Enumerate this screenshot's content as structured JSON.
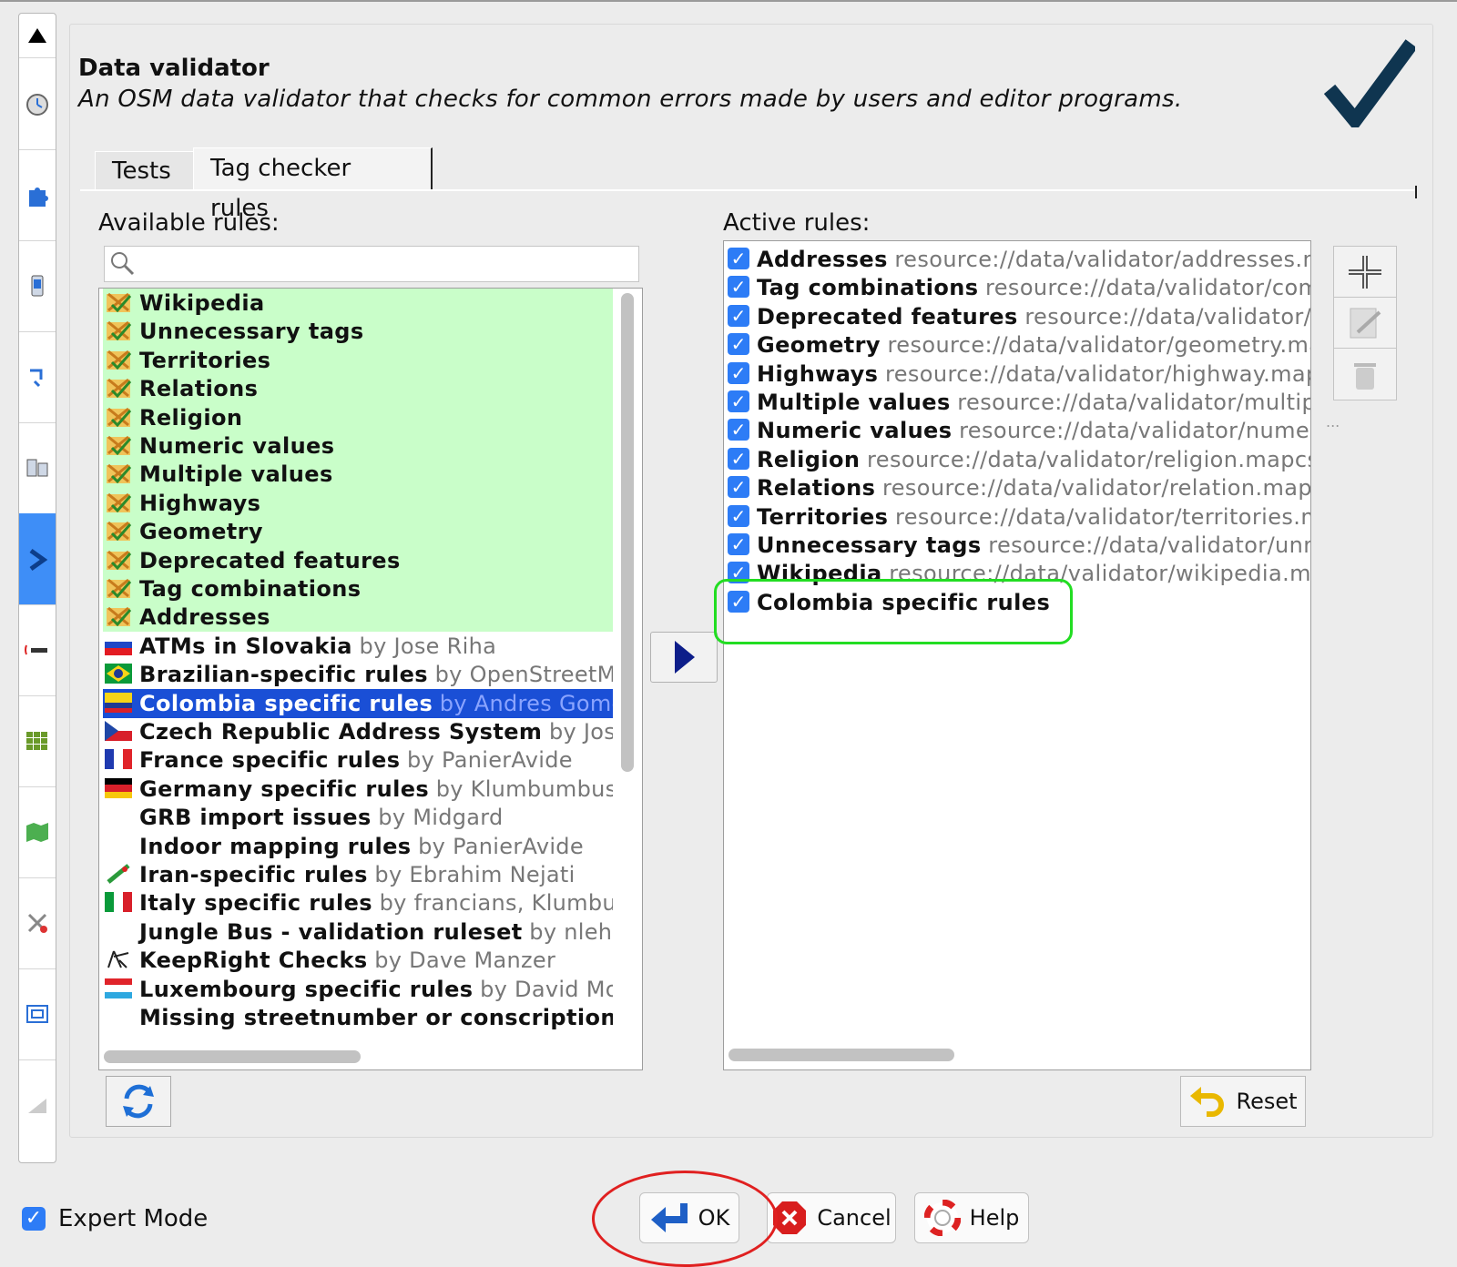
{
  "header": {
    "title": "Data validator",
    "subtitle": "An OSM data validator that checks for common errors made by users and editor programs."
  },
  "tabs": [
    {
      "label": "Tests"
    },
    {
      "label": "Tag checker rules",
      "selected": true
    }
  ],
  "available": {
    "label": "Available rules:",
    "search_placeholder": "",
    "items": [
      {
        "name": "Wikipedia",
        "by": "",
        "icon": "josm-validator-icon",
        "active": true
      },
      {
        "name": "Unnecessary tags",
        "by": "",
        "icon": "josm-validator-icon",
        "active": true
      },
      {
        "name": "Territories",
        "by": "",
        "icon": "josm-validator-icon",
        "active": true
      },
      {
        "name": "Relations",
        "by": "",
        "icon": "josm-validator-icon",
        "active": true
      },
      {
        "name": "Religion",
        "by": "",
        "icon": "josm-validator-icon",
        "active": true
      },
      {
        "name": "Numeric values",
        "by": "",
        "icon": "josm-validator-icon",
        "active": true
      },
      {
        "name": "Multiple values",
        "by": "",
        "icon": "josm-validator-icon",
        "active": true
      },
      {
        "name": "Highways",
        "by": "",
        "icon": "josm-validator-icon",
        "active": true
      },
      {
        "name": "Geometry",
        "by": "",
        "icon": "josm-validator-icon",
        "active": true
      },
      {
        "name": "Deprecated features",
        "by": "",
        "icon": "josm-validator-icon",
        "active": true
      },
      {
        "name": "Tag combinations",
        "by": "",
        "icon": "josm-validator-icon",
        "active": true
      },
      {
        "name": "Addresses",
        "by": "",
        "icon": "josm-validator-icon",
        "active": true
      },
      {
        "name": "ATMs in Slovakia",
        "by": "by Jose Riha",
        "icon": "flag-slovakia-icon"
      },
      {
        "name": "Brazilian-specific rules",
        "by": "by OpenStreetMap",
        "icon": "flag-brazil-icon"
      },
      {
        "name": "Colombia specific rules",
        "by": "by Andres Gomez",
        "icon": "flag-colombia-icon",
        "selected": true
      },
      {
        "name": "Czech Republic Address System",
        "by": "by Jose Ri",
        "icon": "flag-czech-icon"
      },
      {
        "name": "France specific rules",
        "by": "by PanierAvide",
        "icon": "flag-france-icon"
      },
      {
        "name": "Germany specific rules",
        "by": "by Klumbumbus",
        "icon": "flag-germany-icon"
      },
      {
        "name": "GRB import issues",
        "by": "by Midgard",
        "icon": ""
      },
      {
        "name": "Indoor mapping rules",
        "by": "by PanierAvide",
        "icon": ""
      },
      {
        "name": "Iran-specific rules",
        "by": "by Ebrahim Nejati",
        "icon": "flag-iran-icon"
      },
      {
        "name": "Italy specific rules",
        "by": "by francians, Klumbumb",
        "icon": "flag-italy-icon"
      },
      {
        "name": "Jungle Bus - validation ruleset",
        "by": "by nlehuby",
        "icon": ""
      },
      {
        "name": "KeepRight Checks",
        "by": "by Dave Manzer",
        "icon": "keepright-icon"
      },
      {
        "name": "Luxembourg specific rules",
        "by": "by David Morais",
        "icon": "flag-luxembourg-icon"
      },
      {
        "name": "Missing streetnumber or conscriptionnum",
        "by": "",
        "icon": ""
      }
    ]
  },
  "active": {
    "label": "Active rules:",
    "items": [
      {
        "name": "Addresses",
        "res": "resource://data/validator/addresses.ma"
      },
      {
        "name": "Tag combinations",
        "res": "resource://data/validator/combi"
      },
      {
        "name": "Deprecated features",
        "res": "resource://data/validator/dep"
      },
      {
        "name": "Geometry",
        "res": "resource://data/validator/geometry.mapc"
      },
      {
        "name": "Highways",
        "res": "resource://data/validator/highway.mapcs"
      },
      {
        "name": "Multiple values",
        "res": "resource://data/validator/multiple."
      },
      {
        "name": "Numeric values",
        "res": "resource://data/validator/numeric."
      },
      {
        "name": "Religion",
        "res": "resource://data/validator/religion.mapcss"
      },
      {
        "name": "Relations",
        "res": "resource://data/validator/relation.mapcss"
      },
      {
        "name": "Territories",
        "res": "resource://data/validator/territories.map"
      },
      {
        "name": "Unnecessary tags",
        "res": "resource://data/validator/unnece"
      },
      {
        "name": "Wikipedia",
        "res": "resource://data/validator/wikipedia.map"
      },
      {
        "name": "Colombia specific rules",
        "res": ""
      }
    ],
    "dots": "..."
  },
  "buttons": {
    "reset": "Reset",
    "ok": "OK",
    "cancel": "Cancel",
    "help": "Help"
  },
  "expert_mode": {
    "label": "Expert Mode",
    "checked": true
  },
  "colors": {
    "selection": "#1a4fd6",
    "active_green": "#c9fec9",
    "checkbox_blue": "#2d7cf6",
    "annotation_green": "#22dd22",
    "annotation_red": "#e02020"
  }
}
